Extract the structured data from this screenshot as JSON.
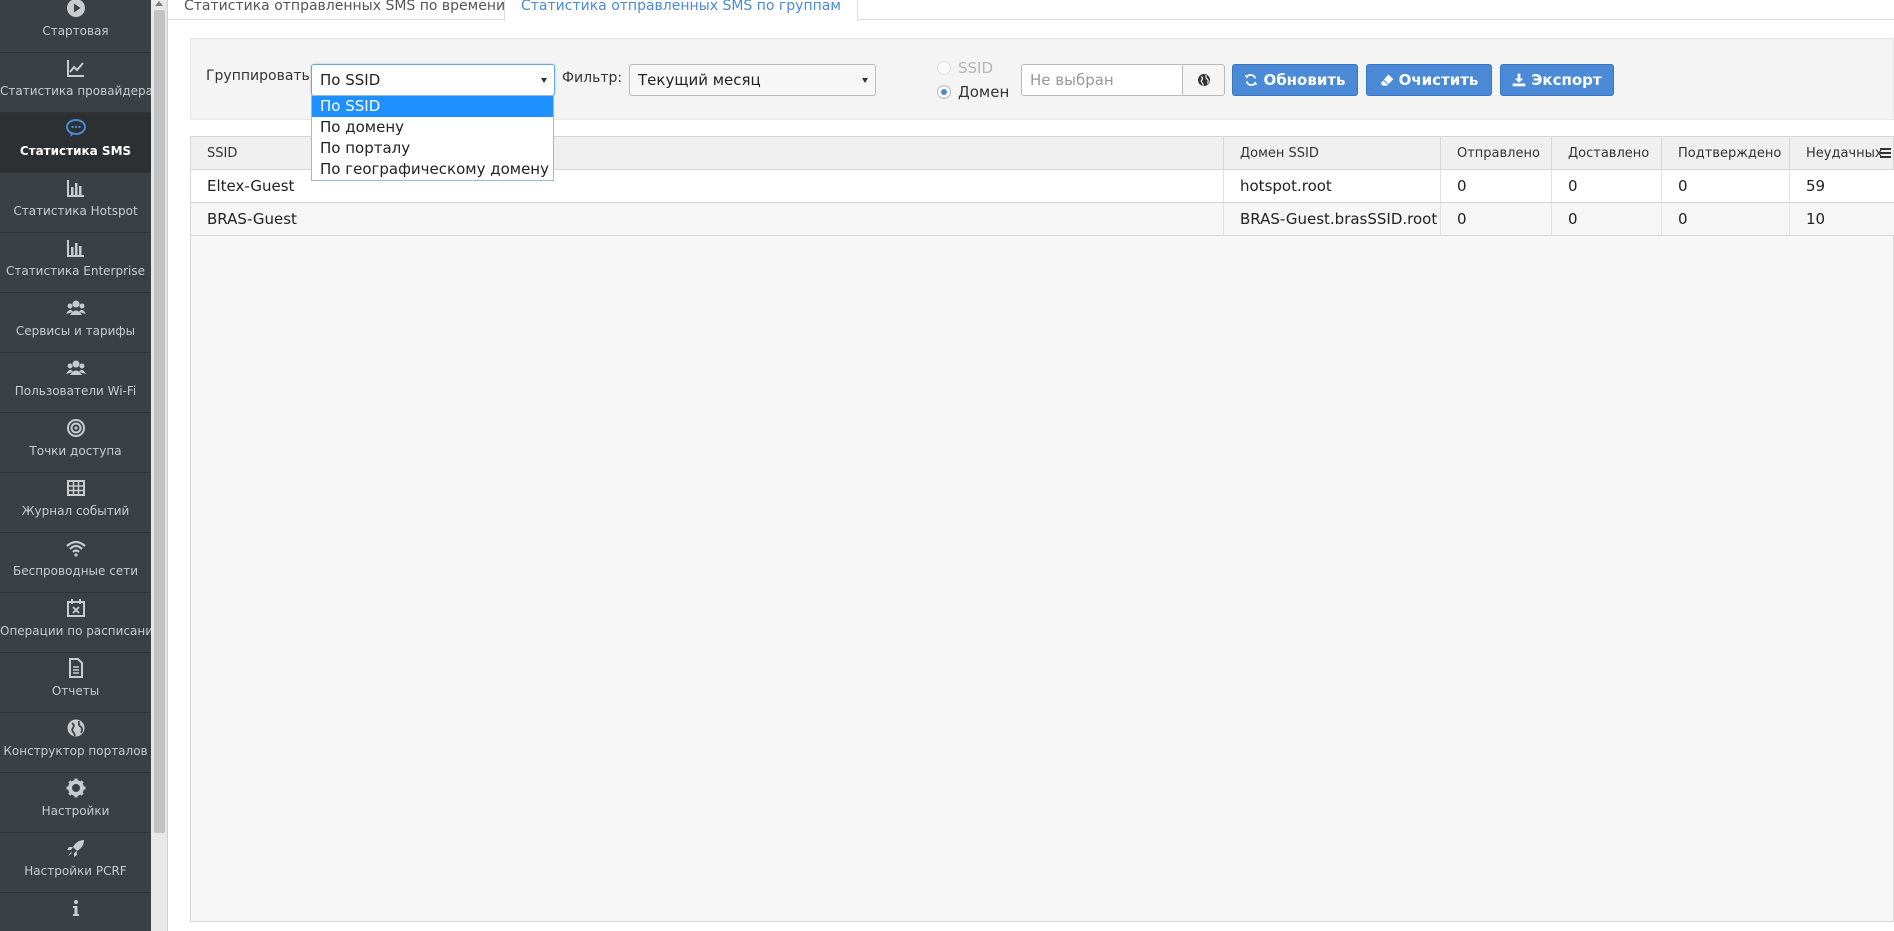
{
  "sidebar": {
    "items": [
      {
        "label": "Стартовая",
        "icon": "play-circle-icon",
        "active": false
      },
      {
        "label": "Статистика провайдера",
        "icon": "line-chart-icon",
        "active": false
      },
      {
        "label": "Статистика SMS",
        "icon": "comment-icon",
        "active": true
      },
      {
        "label": "Статистика Hotspot",
        "icon": "bar-chart-icon",
        "active": false
      },
      {
        "label": "Статистика Enterprise",
        "icon": "bar-chart-icon",
        "active": false
      },
      {
        "label": "Сервисы и тарифы",
        "icon": "users-icon",
        "active": false
      },
      {
        "label": "Пользователи Wi-Fi",
        "icon": "users-icon",
        "active": false
      },
      {
        "label": "Точки доступа",
        "icon": "target-icon",
        "active": false
      },
      {
        "label": "Журнал событий",
        "icon": "table-icon",
        "active": false
      },
      {
        "label": "Беспроводные сети",
        "icon": "wifi-icon",
        "active": false
      },
      {
        "label": "Операции по расписанию",
        "icon": "calendar-icon",
        "active": false
      },
      {
        "label": "Отчеты",
        "icon": "file-icon",
        "active": false
      },
      {
        "label": "Конструктор порталов",
        "icon": "globe-icon",
        "active": false
      },
      {
        "label": "Настройки",
        "icon": "gear-icon",
        "active": false
      },
      {
        "label": "Настройки PCRF",
        "icon": "rocket-icon",
        "active": false
      },
      {
        "label": "",
        "icon": "info-icon",
        "active": false
      }
    ]
  },
  "tabs": [
    {
      "label": "Статистика отправленных SMS по времени",
      "active": false
    },
    {
      "label": "Статистика отправленных SMS по группам",
      "active": true
    }
  ],
  "filters": {
    "group_label": "Группировать",
    "group_value": "По SSID",
    "group_options": [
      "По SSID",
      "По домену",
      "По порталу",
      "По географическому домену"
    ],
    "filter_label": "Фильтр:",
    "filter_value": "Текущий месяц",
    "radio_ssid": "SSID",
    "radio_domain": "Домен",
    "domain_placeholder": "Не выбран",
    "refresh_label": "Обновить",
    "clear_label": "Очистить",
    "export_label": "Экспорт"
  },
  "table": {
    "columns": [
      "SSID",
      "Домен SSID",
      "Отправлено",
      "Доставлено",
      "Подтверждено",
      "Неудачных"
    ],
    "rows": [
      [
        "Eltex-Guest",
        "hotspot.root",
        "0",
        "0",
        "0",
        "59"
      ],
      [
        "BRAS-Guest",
        "BRAS-Guest.brasSSID.root",
        "0",
        "0",
        "0",
        "10"
      ]
    ]
  },
  "colors": {
    "sidebar_bg": "#3b4044",
    "accent": "#4a8ad6",
    "dropdown_selected": "#1e90ff"
  }
}
